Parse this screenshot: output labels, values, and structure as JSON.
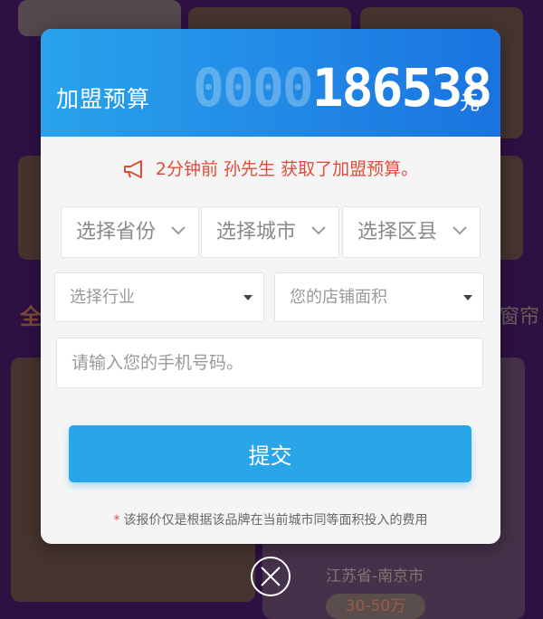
{
  "background": {
    "left_text": "全",
    "right_text": "窗帘",
    "location": "江苏省-南京市",
    "price": "30-50万"
  },
  "budget": {
    "title": "加盟预算",
    "padding_digits": "0000",
    "value": "186538",
    "unit": "元"
  },
  "notice": {
    "icon": "megaphone-icon",
    "text": "2分钟前 孙先生 获取了加盟预算。"
  },
  "selects": {
    "province": "选择省份",
    "city": "选择城市",
    "district": "选择区县",
    "industry": "选择行业",
    "area": "您的店铺面积"
  },
  "phone": {
    "placeholder": "请输入您的手机号码。"
  },
  "submit_label": "提交",
  "disclaimer": {
    "star": "*",
    "text": "该报价仅是根据该品牌在当前城市同等面积投入的费用"
  },
  "colors": {
    "header_start": "#29a3ec",
    "header_end": "#1a73e0",
    "accent": "#29a6e8",
    "notice": "#e24a3b"
  }
}
